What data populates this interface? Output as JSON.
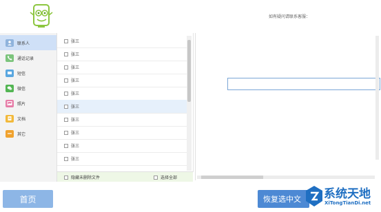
{
  "header": {
    "help_text": "如有疑问请联系客服："
  },
  "sidebar": {
    "items": [
      {
        "label": "联系人",
        "icon": "contacts-icon",
        "color": "#8fb3dc",
        "active": true
      },
      {
        "label": "通话记录",
        "icon": "phone-icon",
        "color": "#7cc47c",
        "active": false
      },
      {
        "label": "短信",
        "icon": "sms-icon",
        "color": "#5aa7e0",
        "active": false
      },
      {
        "label": "微信",
        "icon": "wechat-icon",
        "color": "#53b553",
        "active": false
      },
      {
        "label": "照片",
        "icon": "photo-icon",
        "color": "#e77ea8",
        "active": false
      },
      {
        "label": "文档",
        "icon": "document-icon",
        "color": "#f2b93b",
        "active": false
      },
      {
        "label": "其它",
        "icon": "other-icon",
        "color": "#f0a22e",
        "active": false
      }
    ]
  },
  "contacts": {
    "rows": [
      {
        "name": "张三",
        "selected": false
      },
      {
        "name": "张三",
        "selected": false
      },
      {
        "name": "张三",
        "selected": false
      },
      {
        "name": "张三",
        "selected": false
      },
      {
        "name": "张三",
        "selected": false
      },
      {
        "name": "张三",
        "selected": true
      },
      {
        "name": "张三",
        "selected": false
      },
      {
        "name": "张三",
        "selected": false
      },
      {
        "name": "张三",
        "selected": false
      },
      {
        "name": "张三",
        "selected": false
      }
    ],
    "hide_deleted_label": "隐藏未删除文件",
    "select_all_label": "选择全部"
  },
  "buttons": {
    "home": "首页",
    "restore": "恢复选中文"
  },
  "watermark": {
    "title": "系统天地",
    "url": "XiTongTianDi.net"
  },
  "colors": {
    "accent": "#4d89d4",
    "home_button": "#8db6e6",
    "selected_row": "#e6f0fb"
  }
}
